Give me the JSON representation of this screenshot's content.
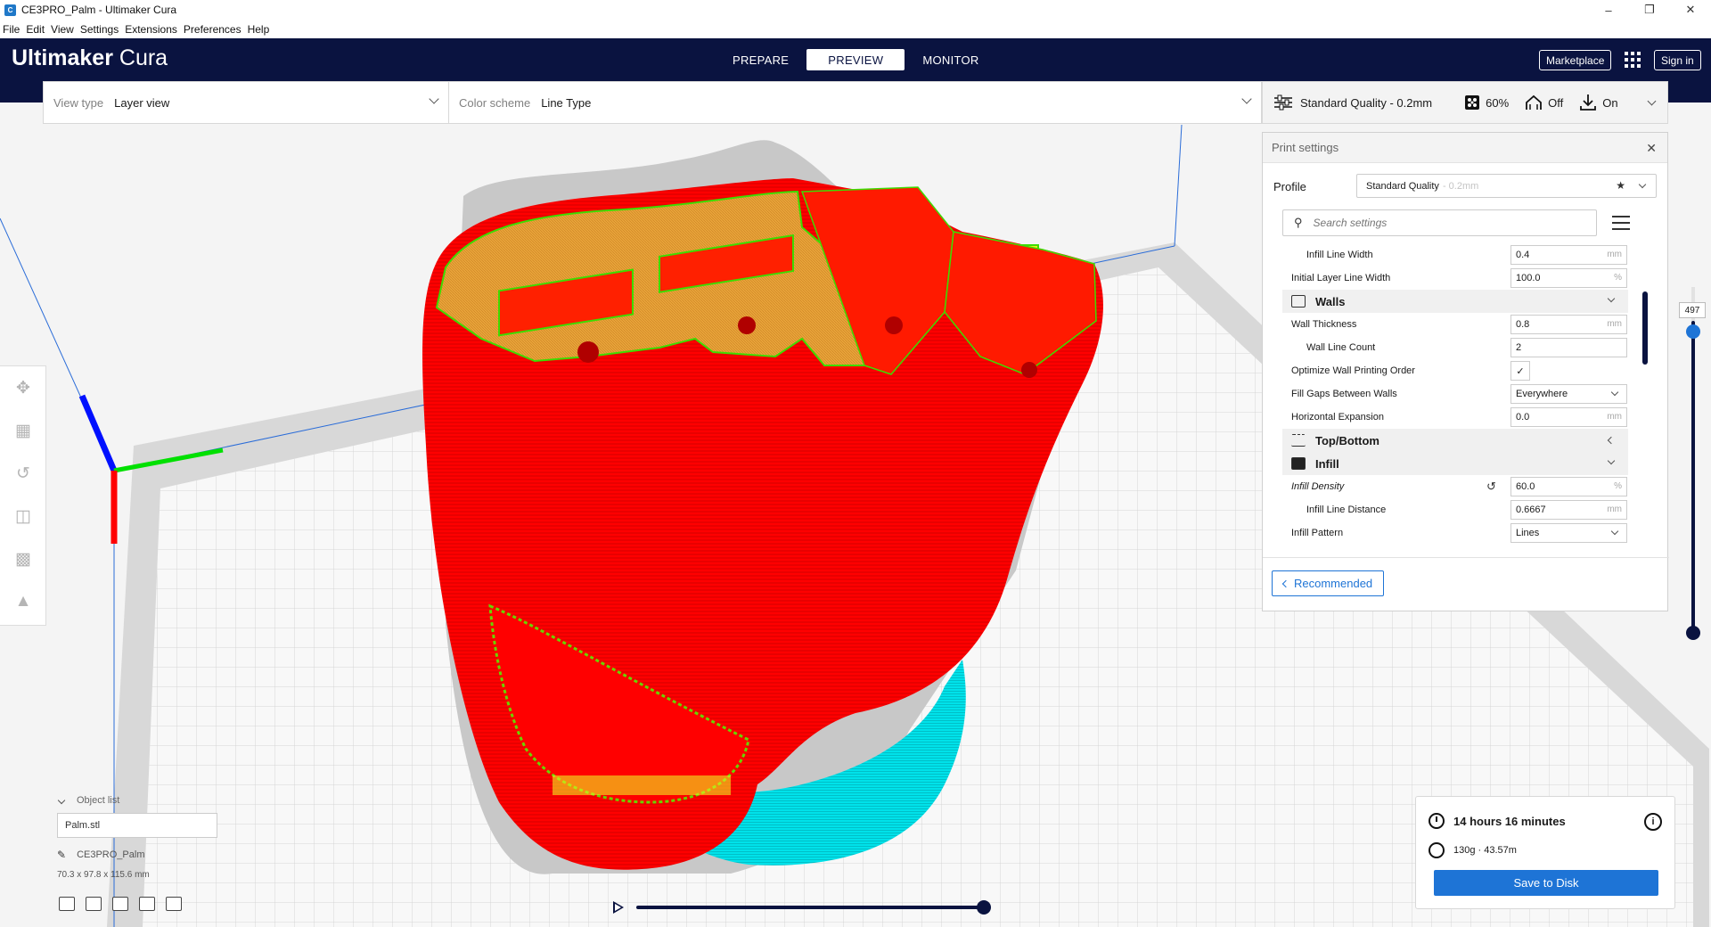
{
  "window": {
    "title": "CE3PRO_Palm - Ultimaker Cura",
    "app_icon": "cura-app-icon"
  },
  "menu": [
    "File",
    "Edit",
    "View",
    "Settings",
    "Extensions",
    "Preferences",
    "Help"
  ],
  "header": {
    "brand_bold": "Ultimaker",
    "brand_light": " Cura",
    "stages": [
      "PREPARE",
      "PREVIEW",
      "MONITOR"
    ],
    "active_stage": "PREVIEW",
    "marketplace_label": "Marketplace",
    "signin_label": "Sign in",
    "background_color": "#0a1340"
  },
  "view_toolbar": {
    "view_type_label": "View type",
    "view_type_value": "Layer view",
    "color_scheme_label": "Color scheme",
    "color_scheme_value": "Line Type"
  },
  "quality_bar": {
    "profile": "Standard Quality - 0.2mm",
    "infill": "60%",
    "support": "Off",
    "adhesion": "On"
  },
  "tools": [
    "move-icon",
    "scale-icon",
    "rotate-icon",
    "mirror-icon",
    "per-model-settings-icon",
    "support-blocker-icon"
  ],
  "print_settings": {
    "title": "Print settings",
    "profile_label": "Profile",
    "profile_value": "Standard Quality",
    "profile_sub": "- 0.2mm",
    "search_placeholder": "Search settings",
    "recommended_label": "Recommended",
    "rows": [
      {
        "type": "setting",
        "name": "Infill Line Width",
        "value": "0.4",
        "unit": "mm",
        "child": true
      },
      {
        "type": "setting",
        "name": "Initial Layer Line Width",
        "value": "100.0",
        "unit": "%",
        "child": false
      },
      {
        "type": "category",
        "name": "Walls",
        "expanded": true
      },
      {
        "type": "setting",
        "name": "Wall Thickness",
        "value": "0.8",
        "unit": "mm",
        "child": false
      },
      {
        "type": "setting",
        "name": "Wall Line Count",
        "value": "2",
        "unit": "",
        "child": true
      },
      {
        "type": "check",
        "name": "Optimize Wall Printing Order",
        "checked": true
      },
      {
        "type": "dropdown",
        "name": "Fill Gaps Between Walls",
        "value": "Everywhere"
      },
      {
        "type": "setting",
        "name": "Horizontal Expansion",
        "value": "0.0",
        "unit": "mm",
        "child": false
      },
      {
        "type": "category",
        "name": "Top/Bottom",
        "expanded": false
      },
      {
        "type": "category",
        "name": "Infill",
        "expanded": true
      },
      {
        "type": "setting",
        "name": "Infill Density",
        "value": "60.0",
        "unit": "%",
        "child": false,
        "italic": true,
        "reset": true
      },
      {
        "type": "setting",
        "name": "Infill Line Distance",
        "value": "0.6667",
        "unit": "mm",
        "child": true
      },
      {
        "type": "dropdown",
        "name": "Infill Pattern",
        "value": "Lines"
      }
    ]
  },
  "layer_slider": {
    "value": "497"
  },
  "object_list": {
    "header": "Object list",
    "item": "Palm.stl",
    "job_name": "CE3PRO_Palm",
    "dimensions": "70.3 x 97.8 x 115.6 mm"
  },
  "print_info": {
    "time": "14 hours 16 minutes",
    "material": "130g · 43.57m",
    "save_label": "Save to Disk"
  },
  "colors": {
    "accent": "#1e74d6",
    "model_red": "#ff0000",
    "skirt_cyan": "#00e0e8",
    "infill_orange": "#e8a33a",
    "wall_green": "#3ddc00",
    "skin_yellow": "#f0f020"
  }
}
